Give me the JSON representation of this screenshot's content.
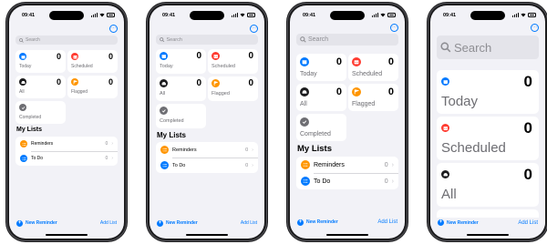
{
  "status": {
    "time": "09:41"
  },
  "search": {
    "placeholder": "Search"
  },
  "smart_lists": {
    "today": {
      "label": "Today",
      "count": "0",
      "color": "#007aff",
      "icon": "calendar-icon"
    },
    "scheduled": {
      "label": "Scheduled",
      "count": "0",
      "color": "#ff3b30",
      "icon": "calendar-grid-icon"
    },
    "all": {
      "label": "All",
      "count": "0",
      "color": "#1c1c1e",
      "icon": "tray-icon"
    },
    "flagged": {
      "label": "Flagged",
      "count": "0",
      "color": "#ff9500",
      "icon": "flag-icon"
    },
    "completed": {
      "label": "Completed",
      "color": "#6e6e73",
      "icon": "checkmark-icon"
    }
  },
  "my_lists": {
    "heading": "My Lists",
    "items": [
      {
        "name": "Reminders",
        "count": "0",
        "color": "#ff9500",
        "icon": "list-bullet-icon"
      },
      {
        "name": "To Do",
        "count": "0",
        "color": "#007aff",
        "icon": "list-bullet-icon"
      }
    ]
  },
  "toolbar": {
    "new_reminder": "New Reminder",
    "add_list": "Add List"
  },
  "more_button": {
    "glyph": "···"
  },
  "chevron": "›",
  "colors": {
    "accent": "#007aff",
    "background": "#f2f2f7"
  }
}
